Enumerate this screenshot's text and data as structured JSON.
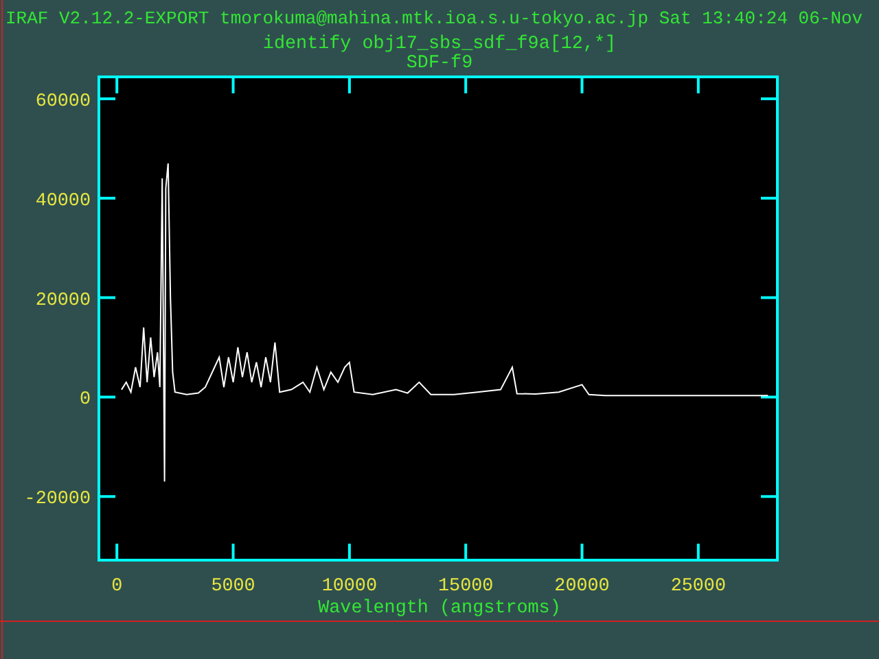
{
  "header": {
    "title": "IRAF V2.12.2-EXPORT tmorokuma@mahina.mtk.ioa.s.u-tokyo.ac.jp Sat 13:40:24 06-Nov",
    "command": "identify obj17_sbs_sdf_f9a[12,*]"
  },
  "plot": {
    "chart_data": {
      "type": "line",
      "title": "SDF-f9",
      "xlabel": "Wavelength (angstroms)",
      "xlim": [
        -774,
        28400
      ],
      "ylim": [
        -32800,
        64400
      ],
      "xticks": [
        0,
        5000,
        10000,
        15000,
        20000,
        25000
      ],
      "yticks": [
        -20000,
        0,
        20000,
        40000,
        60000
      ],
      "x": [
        200,
        400,
        600,
        800,
        1000,
        1150,
        1300,
        1450,
        1600,
        1750,
        1850,
        1950,
        2050,
        2100,
        2200,
        2300,
        2400,
        2500,
        3000,
        3500,
        3800,
        4200,
        4400,
        4600,
        4800,
        5000,
        5200,
        5400,
        5600,
        5800,
        6000,
        6200,
        6400,
        6600,
        6800,
        7000,
        7500,
        8000,
        8300,
        8600,
        8900,
        9200,
        9500,
        9800,
        10000,
        10200,
        11000,
        12000,
        12500,
        13000,
        13500,
        14500,
        15500,
        16500,
        17000,
        17200,
        18000,
        19000,
        20000,
        20300,
        21000,
        28000
      ],
      "values": [
        1500,
        3000,
        1000,
        6000,
        2000,
        14000,
        3000,
        12000,
        4000,
        9000,
        2000,
        44000,
        -17000,
        42000,
        47000,
        20000,
        5000,
        1000,
        500,
        800,
        2000,
        6000,
        8000,
        2000,
        8000,
        3000,
        10000,
        4000,
        9000,
        3000,
        7000,
        2000,
        8000,
        3000,
        11000,
        1000,
        1500,
        3000,
        1000,
        6000,
        1500,
        5000,
        3000,
        6000,
        7000,
        1000,
        500,
        1500,
        800,
        3000,
        500,
        500,
        1000,
        1500,
        6000,
        700,
        600,
        1000,
        2500,
        500,
        300,
        300
      ]
    }
  }
}
